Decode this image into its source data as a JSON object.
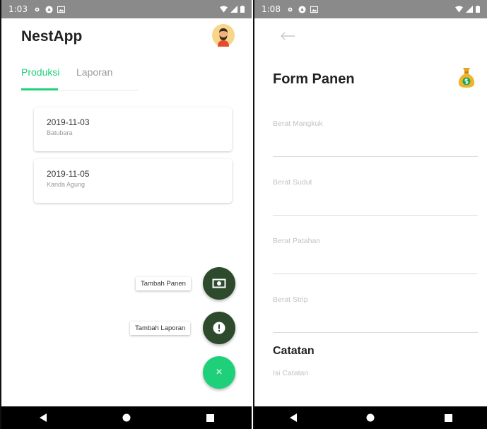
{
  "left_screen": {
    "status": {
      "time": "1:03"
    },
    "app_title": "NestApp",
    "tabs": [
      {
        "label": "Produksi",
        "active": true
      },
      {
        "label": "Laporan",
        "active": false
      }
    ],
    "records": [
      {
        "date": "2019-11-03",
        "location": "Batubara"
      },
      {
        "date": "2019-11-05",
        "location": "Kanda Agung"
      }
    ],
    "fab_actions": [
      {
        "label": "Tambah Panen",
        "icon": "cash-icon"
      },
      {
        "label": "Tambah Laporan",
        "icon": "alert-icon"
      }
    ],
    "fab_close_symbol": "×"
  },
  "right_screen": {
    "status": {
      "time": "1:08"
    },
    "title": "Form Panen",
    "fields": [
      {
        "label": "Berat Mangkuk"
      },
      {
        "label": "Berat Sudut"
      },
      {
        "label": "Berat Patahan"
      },
      {
        "label": "Berat Strip"
      }
    ],
    "notes_section": "Catatan",
    "notes_placeholder": "Isi Catatan"
  },
  "colors": {
    "accent": "#1fd07a",
    "fab_dark": "#2d4a2c",
    "status_bar": "#8a8a8a",
    "nav_bar": "#000000"
  }
}
